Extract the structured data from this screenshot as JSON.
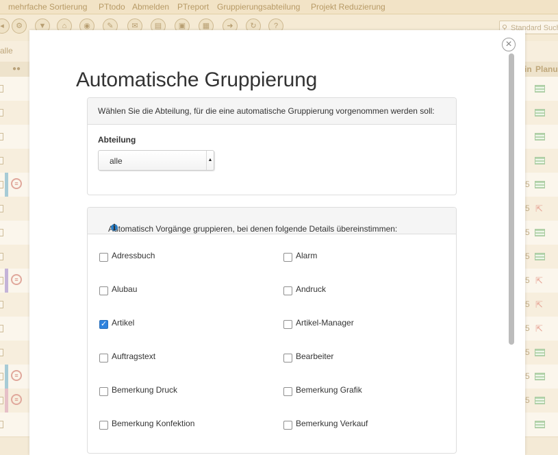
{
  "background": {
    "menu": [
      "mehrfache Sortierung",
      "PTtodo",
      "Abmelden",
      "PTreport",
      "Gruppierungsabteilung",
      "Projekt Reduzierung"
    ],
    "search_placeholder": "Standard Suche",
    "filter_label": "alle",
    "col_in": "in",
    "col_planung": "Planung",
    "row_number": "5"
  },
  "modal": {
    "title": "Automatische Gruppierung",
    "close_symbol": "×",
    "panel1_header": "Wählen Sie die Abteilung, für die eine automatische Gruppierung vorgenommen werden soll:",
    "abteilung_label": "Abteilung",
    "abteilung_value": "alle",
    "panel2_header": "Automatisch Vorgänge gruppieren, bei denen folgende Details übereinstimmen:",
    "checkboxes": [
      {
        "label": "Adressbuch",
        "checked": false
      },
      {
        "label": "Alarm",
        "checked": false
      },
      {
        "label": "Alubau",
        "checked": false
      },
      {
        "label": "Andruck",
        "checked": false
      },
      {
        "label": "Artikel",
        "checked": true
      },
      {
        "label": "Artikel-Manager",
        "checked": false
      },
      {
        "label": "Auftragstext",
        "checked": false
      },
      {
        "label": "Bearbeiter",
        "checked": false
      },
      {
        "label": "Bemerkung Druck",
        "checked": false
      },
      {
        "label": "Bemerkung Grafik",
        "checked": false
      },
      {
        "label": "Bemerkung Konfektion",
        "checked": false
      },
      {
        "label": "Bemerkung Verkauf",
        "checked": false
      }
    ]
  }
}
